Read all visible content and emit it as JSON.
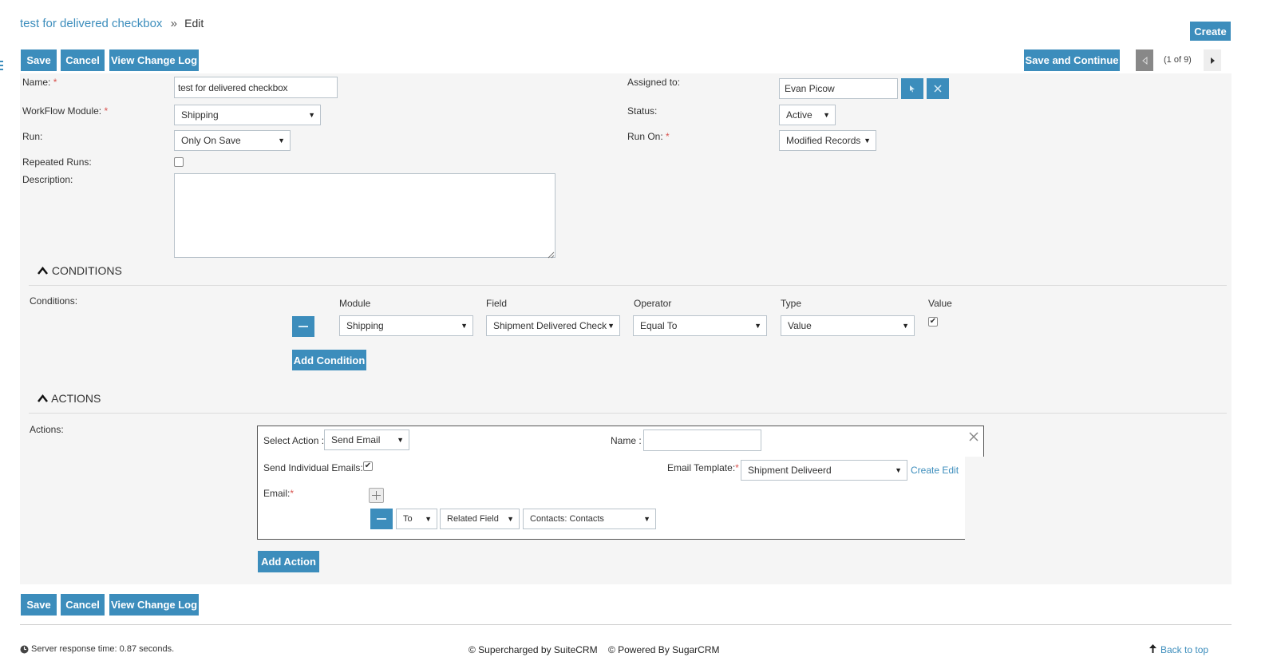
{
  "header": {
    "record_title": "test for delivered checkbox",
    "separator": "»",
    "mode": "Edit",
    "create_label": "Create"
  },
  "toolbar": {
    "save_label": "Save",
    "cancel_label": "Cancel",
    "change_log_label": "View Change Log",
    "save_continue_label": "Save and Continue",
    "pagination": "(1 of 9)"
  },
  "form": {
    "name_label": "Name:",
    "name_value": "test for delivered checkbox",
    "workflow_module_label": "WorkFlow Module:",
    "workflow_module_value": "Shipping",
    "run_label": "Run:",
    "run_value": "Only On Save",
    "repeated_runs_label": "Repeated Runs:",
    "repeated_runs_checked": false,
    "description_label": "Description:",
    "description_value": "",
    "assigned_to_label": "Assigned to:",
    "assigned_to_value": "Evan Picow",
    "status_label": "Status:",
    "status_value": "Active",
    "run_on_label": "Run On:",
    "run_on_value": "Modified Records",
    "required_mark": "*"
  },
  "conditions": {
    "section_title": "CONDITIONS",
    "label": "Conditions:",
    "columns": [
      "Module",
      "Field",
      "Operator",
      "Type",
      "Value"
    ],
    "rows": [
      {
        "module": "Shipping",
        "field": "Shipment Delivered Check",
        "operator": "Equal To",
        "type": "Value",
        "value_checked": true
      }
    ],
    "add_label": "Add Condition"
  },
  "actions": {
    "section_title": "ACTIONS",
    "label": "Actions:",
    "select_action_label": "Select Action :",
    "select_action_value": "Send Email",
    "name_label": "Name :",
    "name_value": "",
    "send_individual_label": "Send Individual Emails:",
    "send_individual_checked": true,
    "email_template_label": "Email Template:",
    "email_template_value": "Shipment Deliveerd",
    "create_link": "Create",
    "edit_link": "Edit",
    "email_label": "Email:",
    "recipient": {
      "to": "To",
      "type": "Related Field",
      "field": "Contacts: Contacts"
    },
    "add_label": "Add Action"
  },
  "footer": {
    "server_response": "Server response time: 0.87 seconds.",
    "supercharged": "© Supercharged by SuiteCRM",
    "powered": "© Powered By SugarCRM",
    "back_to_top": "Back to top"
  },
  "colors": {
    "accent": "#3c8dbc",
    "required": "#d9534f",
    "panel": "#f5f5f5"
  },
  "icons": [
    "sidebar-toggle-icon",
    "select-user-icon",
    "clear-user-icon",
    "prev-record-icon",
    "next-record-icon",
    "collapse-icon",
    "remove-icon",
    "close-icon",
    "plus-icon",
    "clock-icon",
    "arrow-up-icon"
  ]
}
